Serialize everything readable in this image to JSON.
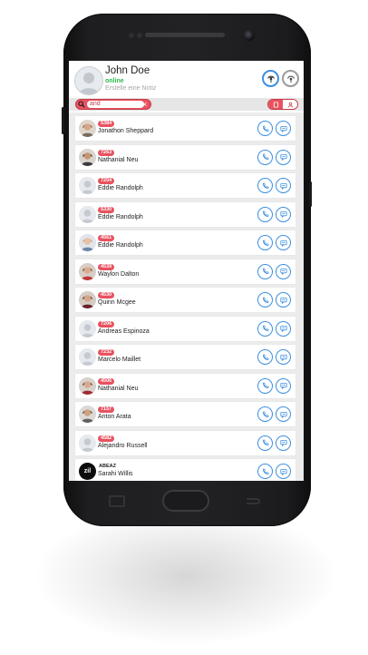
{
  "header": {
    "name": "John Doe",
    "status": "online",
    "note_placeholder": "Erstelle eine Notiz",
    "colors": {
      "status": "#2bb84a",
      "accent": "#3d8fe0",
      "brand_red": "#e8525f"
    }
  },
  "search": {
    "value": "and",
    "clear_icon": "×"
  },
  "contacts": [
    {
      "ext": "5384",
      "name": "Jonathon Sheppard",
      "avatar": "photo-woman-1"
    },
    {
      "ext": "7263",
      "name": "Nathanial Neu",
      "avatar": "photo-man-1"
    },
    {
      "ext": "7204",
      "name": "Eddie Randolph",
      "avatar": "default"
    },
    {
      "ext": "5330",
      "name": "Eddie Randolph",
      "avatar": "default"
    },
    {
      "ext": "4561",
      "name": "Eddie Randolph",
      "avatar": "photo-woman-2"
    },
    {
      "ext": "4539",
      "name": "Waylon Dalton",
      "avatar": "photo-woman-3"
    },
    {
      "ext": "4530",
      "name": "Quinn Mcgee",
      "avatar": "photo-woman-4"
    },
    {
      "ext": "7206",
      "name": "Andreas Espinoza",
      "avatar": "default"
    },
    {
      "ext": "7232",
      "name": "Marcelo Maillet",
      "avatar": "default"
    },
    {
      "ext": "4506",
      "name": "Nathanial Neu",
      "avatar": "photo-woman-5"
    },
    {
      "ext": "7157",
      "name": "Anton Arata",
      "avatar": "photo-man-2"
    },
    {
      "ext": "4582",
      "name": "Alejandro Russell",
      "avatar": "default"
    },
    {
      "company": "ABEAZ",
      "name": "Sarahi Willis",
      "avatar": "zil",
      "avatar_text": "zil"
    }
  ]
}
